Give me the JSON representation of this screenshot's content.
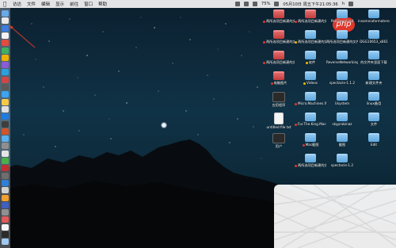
{
  "menubar": {
    "apple": "",
    "items": [
      "访达",
      "文件",
      "编辑",
      "显示",
      "前往",
      "窗口",
      "帮助"
    ],
    "battery": "75%",
    "datetime": "05月10日 周五下午21:05:36",
    "user": "h"
  },
  "watermark": "php",
  "desktop": {
    "col1": [
      {
        "label": "两所选项目新建的文件夹 6",
        "icon": "redfolder",
        "dot": "#e0372b"
      },
      {
        "label": "两所选项目新建的文件夹 4",
        "icon": "redfolder",
        "dot": "#e0372b"
      },
      {
        "label": "两所选项目新建的文件夹 4",
        "icon": "redfolder",
        "dot": "#e0372b"
      },
      {
        "label": "电脑图片",
        "icon": "redfolder",
        "dot": "#e0372b"
      },
      {
        "label": "应用程序",
        "icon": "dark",
        "dot": ""
      },
      {
        "label": "untitled file.txt",
        "icon": "doc",
        "dot": ""
      },
      {
        "label": "用户",
        "icon": "dark",
        "dot": ""
      }
    ],
    "col2": [
      {
        "label": "两所选项目新建的文件夹 15",
        "icon": "redfolder",
        "dot": "#e0372b"
      },
      {
        "label": "两所选项目新建的文件夹",
        "icon": "folder",
        "dot": "#f5b800"
      },
      {
        "label": "软件",
        "icon": "folder",
        "dot": "#f5b800"
      },
      {
        "label": "Videos",
        "icon": "folder",
        "dot": "#f5b800"
      },
      {
        "label": "Micro.Machines.Worl...IVATED",
        "icon": "folder",
        "dot": "#e0372b"
      },
      {
        "label": "For.The.King.MacOS...IVATED",
        "icon": "folder",
        "dot": "#e0372b"
      },
      {
        "label": "Mac截图",
        "icon": "folder",
        "dot": "#e0372b"
      },
      {
        "label": "两所选项目新建的文件夹",
        "icon": "folder",
        "dot": "#e0372b"
      }
    ],
    "col3": [
      {
        "label": "PanDownload",
        "icon": "folder",
        "dot": ""
      },
      {
        "label": "两所选项目新建的文件夹 13",
        "icon": "folder",
        "dot": ""
      },
      {
        "label": "ReverseNetworkingServer_1.2.0",
        "icon": "folder",
        "dot": ""
      },
      {
        "label": "spectacle-1.1.2",
        "icon": "folder",
        "dot": ""
      },
      {
        "label": "Usystem",
        "icon": "folder",
        "dot": ""
      },
      {
        "label": "skyprobinaz",
        "icon": "folder",
        "dot": ""
      },
      {
        "label": "截图",
        "icon": "folder",
        "dot": ""
      },
      {
        "label": "spectacle-1.2",
        "icon": "folder",
        "dot": ""
      }
    ],
    "col4": [
      {
        "label": "insomniaformaterofMd_x661",
        "icon": "folder",
        "dot": ""
      },
      {
        "label": "DGG10653_x661",
        "icon": "folder",
        "dot": ""
      },
      {
        "label": "的文件夹里面下载",
        "icon": "folder",
        "dot": ""
      },
      {
        "label": "新建文件夹",
        "icon": "folder",
        "dot": ""
      },
      {
        "label": "linux备用",
        "icon": "folder",
        "dot": ""
      },
      {
        "label": "文件",
        "icon": "folder",
        "dot": ""
      },
      {
        "label": "Edit",
        "icon": "folder",
        "dot": ""
      }
    ]
  }
}
